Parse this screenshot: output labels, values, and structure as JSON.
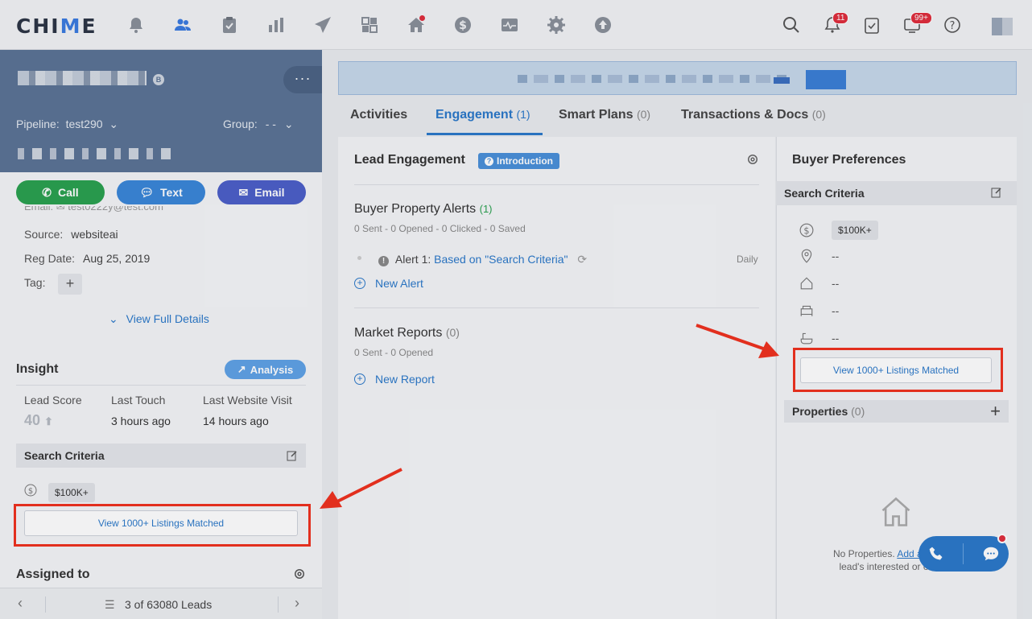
{
  "app": {
    "logo_text": "CHIME"
  },
  "topbar": {
    "nav_icons": [
      "alert-bell-icon",
      "people-icon",
      "clipboard-icon",
      "bar-chart-icon",
      "paper-plane-icon",
      "grid-icon",
      "home-icon",
      "dollar-icon",
      "activity-icon",
      "gear-icon",
      "upload-icon"
    ],
    "notifications_badge": "11",
    "messages_badge": "99+"
  },
  "profile": {
    "name_badge": "B",
    "more_label": "···",
    "pipeline_label": "Pipeline:",
    "pipeline_value": "test290",
    "group_label": "Group:",
    "group_value": "- -"
  },
  "actions": {
    "call": "Call",
    "text": "Text",
    "email": "Email"
  },
  "details": {
    "email_row": "Email:  ✉  test0222y@test.com",
    "source_label": "Source:",
    "source_value": "websiteai",
    "reg_label": "Reg Date:",
    "reg_value": "Aug 25, 2019",
    "tag_label": "Tag:",
    "view_full": "View Full Details"
  },
  "insight": {
    "title": "Insight",
    "analysis_btn": "Analysis",
    "lead_score_label": "Lead Score",
    "lead_score_value": "40",
    "last_touch_label": "Last Touch",
    "last_touch_value": "3 hours ago",
    "last_visit_label": "Last Website Visit",
    "last_visit_value": "14 hours ago"
  },
  "left_search": {
    "title": "Search Criteria",
    "price": "$100K+",
    "listings_btn": "View 1000+ Listings Matched"
  },
  "assigned": {
    "title": "Assigned to"
  },
  "pager": {
    "text": "3 of 63080 Leads"
  },
  "tabs": [
    {
      "label": "Activities",
      "count": ""
    },
    {
      "label": "Engagement",
      "count": "(1)"
    },
    {
      "label": "Smart Plans",
      "count": "(0)"
    },
    {
      "label": "Transactions & Docs",
      "count": "(0)"
    }
  ],
  "engagement": {
    "title": "Lead Engagement",
    "intro_badge": "Introduction",
    "alerts_title": "Buyer Property Alerts",
    "alerts_count": "(1)",
    "alerts_stats": "0 Sent - 0 Opened - 0 Clicked - 0 Saved",
    "alert_prefix": "Alert 1:",
    "alert_link": "Based on \"Search Criteria\"",
    "alert_freq": "Daily",
    "new_alert": "New Alert",
    "reports_title": "Market Reports",
    "reports_count": "(0)",
    "reports_stats": "0 Sent - 0 Opened",
    "new_report": "New Report"
  },
  "buyer_prefs": {
    "title": "Buyer Preferences",
    "search_title": "Search Criteria",
    "price": "$100K+",
    "location": "--",
    "type": "--",
    "beds": "--",
    "baths": "--",
    "listings_btn": "View 1000+ Listings Matched",
    "properties_label": "Properties",
    "properties_count": "(0)",
    "no_props_text": "No Properties.",
    "no_props_link": "Add a property",
    "no_props_text2": "lead's interested or owned."
  },
  "colors": {
    "accent": "#2b79c9",
    "annotation": "#f0311e",
    "call": "#2aa14f",
    "text": "#3a86d8",
    "email": "#4c5fc8"
  }
}
